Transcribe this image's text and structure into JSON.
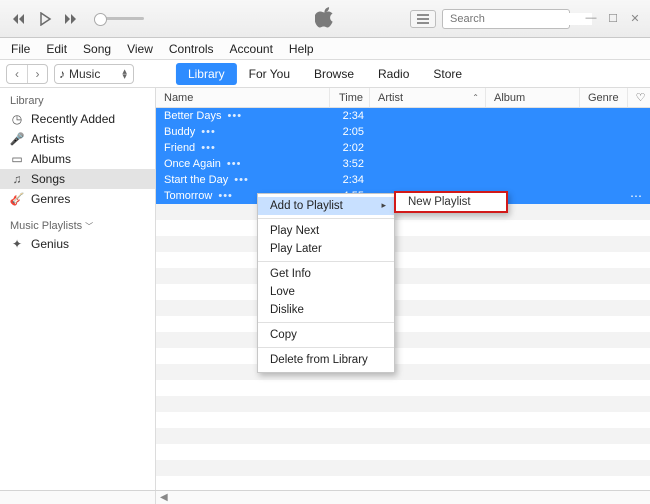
{
  "search": {
    "placeholder": "Search"
  },
  "menus": [
    "File",
    "Edit",
    "Song",
    "View",
    "Controls",
    "Account",
    "Help"
  ],
  "source": {
    "label": "Music"
  },
  "tabs": [
    {
      "label": "Library",
      "active": true
    },
    {
      "label": "For You"
    },
    {
      "label": "Browse"
    },
    {
      "label": "Radio"
    },
    {
      "label": "Store"
    }
  ],
  "sidebar": {
    "section1": {
      "title": "Library",
      "items": [
        {
          "label": "Recently Added",
          "icon": "clock"
        },
        {
          "label": "Artists",
          "icon": "mic"
        },
        {
          "label": "Albums",
          "icon": "album"
        },
        {
          "label": "Songs",
          "icon": "note",
          "active": true
        },
        {
          "label": "Genres",
          "icon": "guitar"
        }
      ]
    },
    "section2": {
      "title": "Music Playlists",
      "items": [
        {
          "label": "Genius",
          "icon": "genius"
        }
      ]
    }
  },
  "columns": {
    "name": "Name",
    "time": "Time",
    "artist": "Artist",
    "album": "Album",
    "genre": "Genre"
  },
  "songs": [
    {
      "name": "Better Days",
      "time": "2:34"
    },
    {
      "name": "Buddy",
      "time": "2:05"
    },
    {
      "name": "Friend",
      "time": "2:02"
    },
    {
      "name": "Once Again",
      "time": "3:52"
    },
    {
      "name": "Start the Day",
      "time": "2:34"
    },
    {
      "name": "Tomorrow",
      "time": "4:55"
    }
  ],
  "context_menu": {
    "items": [
      {
        "label": "Add to Playlist",
        "highlight": true,
        "submenu": true
      },
      {
        "sep": true
      },
      {
        "label": "Play Next"
      },
      {
        "label": "Play Later"
      },
      {
        "sep": true
      },
      {
        "label": "Get Info"
      },
      {
        "label": "Love"
      },
      {
        "label": "Dislike"
      },
      {
        "sep": true
      },
      {
        "label": "Copy"
      },
      {
        "sep": true
      },
      {
        "label": "Delete from Library"
      }
    ],
    "submenu_label": "New Playlist"
  }
}
